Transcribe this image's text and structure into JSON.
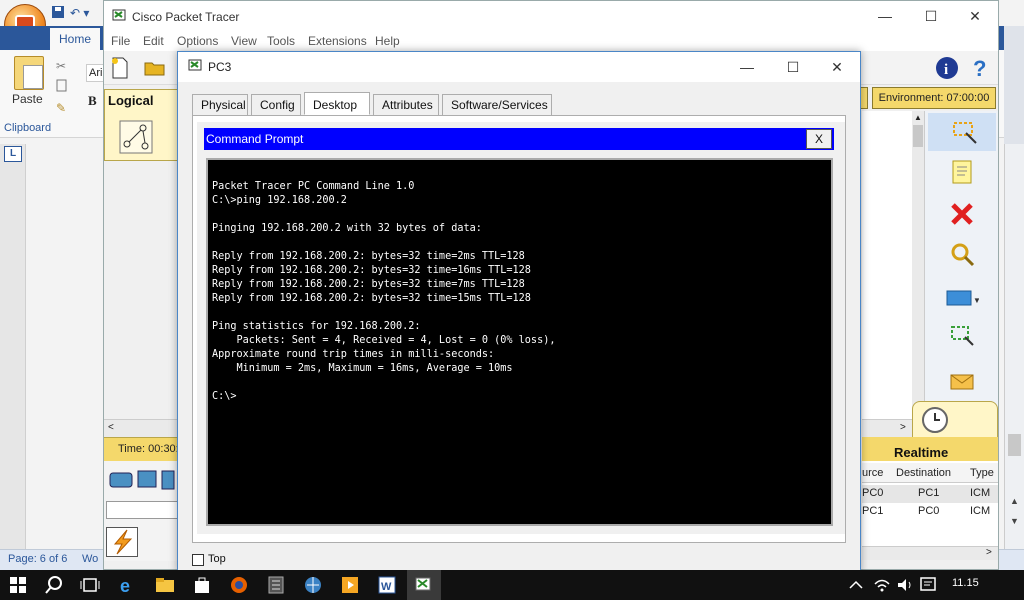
{
  "word": {
    "home_tab": "Home",
    "paste_label": "Paste",
    "clipboard_label": "Clipboard",
    "font_name_partial": "Ari",
    "bold_label": "B",
    "page_status": "Page: 6 of 6",
    "status_partial": "Wo",
    "ruler_marker": "L"
  },
  "packet_tracer": {
    "title": "Cisco Packet Tracer",
    "menu": [
      "File",
      "Edit",
      "Options",
      "View",
      "Tools",
      "Extensions",
      "Help"
    ],
    "logical_label": "Logical",
    "environment": "Environment: 07:00:00",
    "time": "Time: 00:30:",
    "realtime_label": "Realtime",
    "events": {
      "headers": [
        "urce",
        "Destination",
        "Type"
      ],
      "rows": [
        [
          "PC0",
          "PC1",
          "ICM"
        ],
        [
          "PC1",
          "PC0",
          "ICM"
        ]
      ]
    }
  },
  "pc3": {
    "title": "PC3",
    "tabs": [
      "Physical",
      "Config",
      "Desktop",
      "Attributes",
      "Software/Services"
    ],
    "active_tab": "Desktop",
    "top_checkbox_label": "Top",
    "cmd": {
      "title": "Command Prompt",
      "close_label": "X",
      "lines": [
        "Packet Tracer PC Command Line 1.0",
        "C:\\>ping 192.168.200.2",
        "",
        "Pinging 192.168.200.2 with 32 bytes of data:",
        "",
        "Reply from 192.168.200.2: bytes=32 time=2ms TTL=128",
        "Reply from 192.168.200.2: bytes=32 time=16ms TTL=128",
        "Reply from 192.168.200.2: bytes=32 time=7ms TTL=128",
        "Reply from 192.168.200.2: bytes=32 time=15ms TTL=128",
        "",
        "Ping statistics for 192.168.200.2:",
        "    Packets: Sent = 4, Received = 4, Lost = 0 (0% loss),",
        "Approximate round trip times in milli-seconds:",
        "    Minimum = 2ms, Maximum = 16ms, Average = 10ms",
        "",
        "C:\\>"
      ]
    }
  },
  "taskbar": {
    "clock": "11.15"
  },
  "colors": {
    "word_blue": "#2b579a",
    "cmd_title_bar": "#0000ff",
    "pt_yellow": "#f4d86b"
  }
}
